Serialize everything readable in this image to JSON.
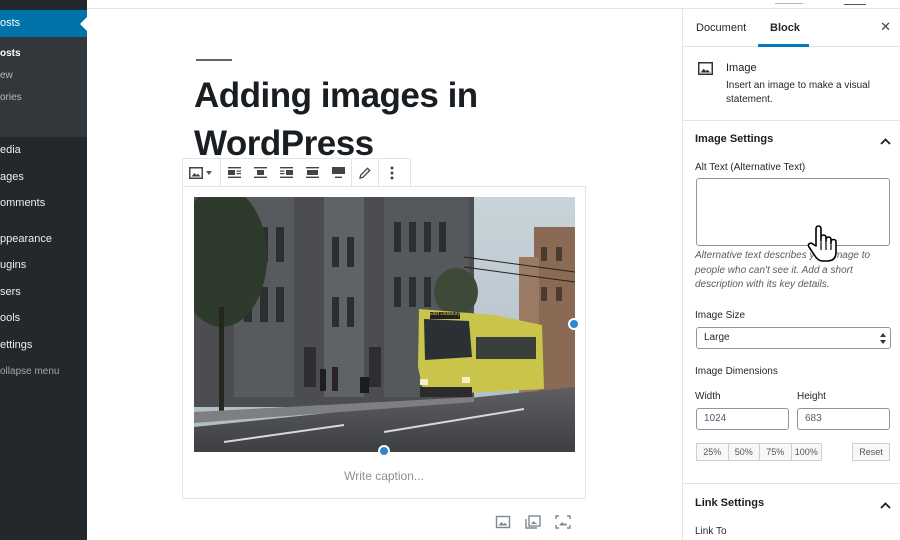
{
  "admin_menu": {
    "posts": "osts",
    "submenu": [
      "osts",
      "ew",
      "ories"
    ],
    "items": [
      "edia",
      "ages",
      "omments",
      "ppearance",
      "ugins",
      "sers",
      "ools",
      "ettings"
    ],
    "collapse": "ollapse menu"
  },
  "editor": {
    "title": "Adding images in WordPress",
    "caption_placeholder": "Write caption...",
    "photo_sign": "East Didsbury"
  },
  "settings": {
    "tabs": [
      "Document",
      "Block"
    ],
    "block_name": "Image",
    "block_description": "Insert an image to make a visual statement.",
    "image_settings_title": "Image Settings",
    "alt_text_label": "Alt Text (Alternative Text)",
    "alt_text_value": "",
    "alt_help": "Alternative text describes your image to people who can't see it. Add a short description with its key details.",
    "image_size_label": "Image Size",
    "image_size_value": "Large",
    "dimensions_label": "Image Dimensions",
    "width_label": "Width",
    "width_value": "1024",
    "height_label": "Height",
    "height_value": "683",
    "scale_buttons": [
      "25%",
      "50%",
      "75%",
      "100%"
    ],
    "reset_label": "Reset",
    "link_settings_title": "Link Settings",
    "link_to_label": "Link To"
  },
  "colors": {
    "accent": "#0073aa",
    "admin_bg": "#23282d",
    "handle": "#2e87d1"
  }
}
